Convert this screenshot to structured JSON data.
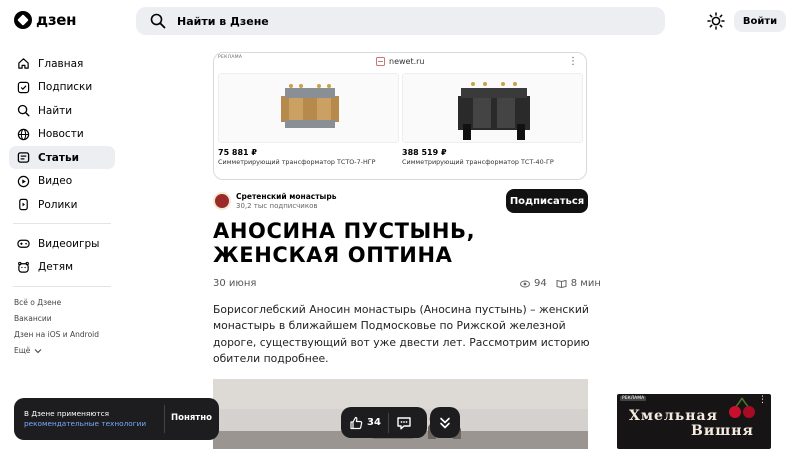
{
  "header": {
    "logo_text": "дзен",
    "search_placeholder": "Найти в Дзене",
    "login_label": "Войти"
  },
  "sidebar": {
    "items": [
      {
        "label": "Главная",
        "icon": "home-icon"
      },
      {
        "label": "Подписки",
        "icon": "subscriptions-icon"
      },
      {
        "label": "Найти",
        "icon": "search-icon"
      },
      {
        "label": "Новости",
        "icon": "news-icon"
      },
      {
        "label": "Статьи",
        "icon": "articles-icon",
        "active": true
      },
      {
        "label": "Видео",
        "icon": "video-icon"
      },
      {
        "label": "Ролики",
        "icon": "shorts-icon"
      }
    ],
    "secondary_items": [
      {
        "label": "Видеоигры",
        "icon": "gamepad-icon"
      },
      {
        "label": "Детям",
        "icon": "kids-icon"
      }
    ],
    "footer_links": [
      "Всё о Дзене",
      "Вакансии",
      "Дзен на iOS и Android",
      "Ещё"
    ]
  },
  "ad": {
    "label": "РЕКЛАМА",
    "domain": "newet.ru",
    "products": [
      {
        "price": "75 881 ₽",
        "desc": "Симметрирующий трансформатор ТСТО-7-НГР"
      },
      {
        "price": "388 519 ₽",
        "desc": "Симметрирующий трансформатор ТСТ-40-ГР"
      }
    ]
  },
  "channel": {
    "name": "Сретенский монастырь",
    "subscribers": "30,2 тыс подписчиков",
    "subscribe_label": "Подписаться"
  },
  "article": {
    "title": "АНОСИНА ПУСТЫНЬ, ЖЕНСКАЯ ОПТИНА",
    "date": "30 июня",
    "views": "94",
    "read_time": "8 мин",
    "body": "Борисоглебский Аносин монастырь (Аносина пустынь) – женский монастырь в ближайшем Подмосковье по Рижской железной дороге, существующий вот уже двести лет. Рассмотрим историю обители подробнее."
  },
  "reactions": {
    "likes": "34"
  },
  "cookie": {
    "text": "В Дзене применяются",
    "link": "рекомендательные технологии",
    "ok_label": "Понятно"
  },
  "side_ad": {
    "label": "РЕКЛАМА",
    "text_line1": "Хмельная",
    "text_line2": "Вишня"
  }
}
